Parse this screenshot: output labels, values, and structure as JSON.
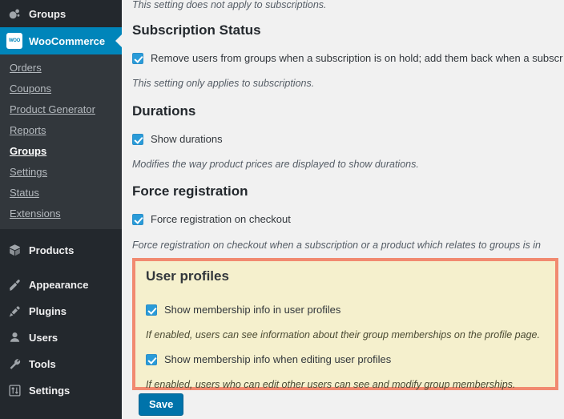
{
  "sidebar": {
    "top_items": [
      {
        "label": "Groups",
        "icon": "groups-bubbles-icon",
        "current": false
      },
      {
        "label": "WooCommerce",
        "icon": "woocommerce-icon",
        "current": true
      }
    ],
    "submenu": [
      {
        "label": "Orders",
        "current": false
      },
      {
        "label": "Coupons",
        "current": false
      },
      {
        "label": "Product Generator",
        "current": false
      },
      {
        "label": "Reports",
        "current": false
      },
      {
        "label": "Groups",
        "current": true
      },
      {
        "label": "Settings",
        "current": false
      },
      {
        "label": "Status",
        "current": false
      },
      {
        "label": "Extensions",
        "current": false
      }
    ],
    "lower_items": [
      {
        "label": "Products",
        "icon": "box-icon"
      },
      {
        "label": "Appearance",
        "icon": "paintbrush-icon"
      },
      {
        "label": "Plugins",
        "icon": "plug-icon"
      },
      {
        "label": "Users",
        "icon": "user-icon"
      },
      {
        "label": "Tools",
        "icon": "wrench-icon"
      },
      {
        "label": "Settings",
        "icon": "sliders-icon"
      }
    ]
  },
  "main": {
    "top_partial_desc": "This setting does not apply to subscriptions.",
    "sections": [
      {
        "title": "Subscription Status",
        "checkbox_label": "Remove users from groups when a subscription is on hold; add them back when a subscr",
        "checkbox_checked": true,
        "desc": "This setting only applies to subscriptions."
      },
      {
        "title": "Durations",
        "checkbox_label": "Show durations",
        "checkbox_checked": true,
        "desc": "Modifies the way product prices are displayed to show durations."
      },
      {
        "title": "Force registration",
        "checkbox_label": "Force registration on checkout",
        "checkbox_checked": true,
        "desc": "Force registration on checkout when a subscription or a product which relates to groups is in"
      }
    ],
    "highlight": {
      "title": "User profiles",
      "rows": [
        {
          "checkbox_label": "Show membership info in user profiles",
          "checkbox_checked": true,
          "desc": "If enabled, users can see information about their group memberships on the profile page."
        },
        {
          "checkbox_label": "Show membership info when editing user profiles",
          "checkbox_checked": true,
          "desc": "If enabled, users who can edit other users can see and modify group memberships."
        }
      ]
    },
    "save_label": "Save"
  },
  "colors": {
    "sidebar_bg": "#23282d",
    "submenu_bg": "#32373c",
    "accent_blue": "#0085ba",
    "save_blue": "#0073aa",
    "checkbox_blue": "#2a9bd8",
    "highlight_border": "#f18a70",
    "highlight_fill": "#f5f0cd",
    "content_bg": "#f1f1f1"
  }
}
